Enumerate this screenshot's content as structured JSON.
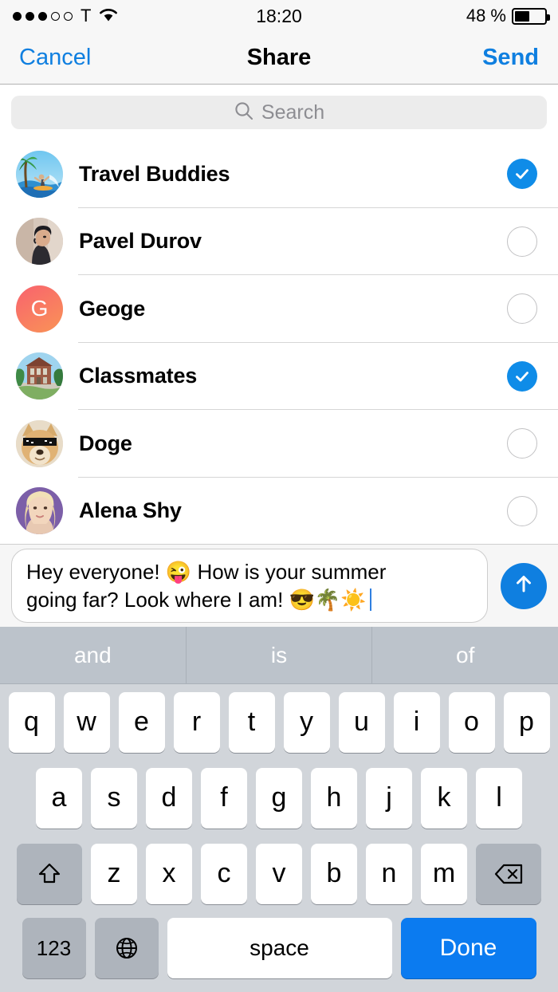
{
  "status_bar": {
    "signal_dots_filled": 3,
    "signal_dots_total": 5,
    "carrier": "T",
    "wifi_icon": "wifi-icon",
    "time": "18:20",
    "battery_percent": "48 %",
    "battery_level": 48
  },
  "navbar": {
    "cancel_label": "Cancel",
    "title": "Share",
    "send_label": "Send"
  },
  "search": {
    "icon": "search-icon",
    "placeholder": "Search",
    "value": ""
  },
  "chat_list": [
    {
      "name": "Travel Buddies",
      "avatar": "beach-surfer-photo",
      "avatar_type": "photo",
      "selected": true
    },
    {
      "name": "Pavel Durov",
      "avatar": "man-portrait-photo",
      "avatar_type": "photo",
      "selected": false
    },
    {
      "name": "Geoge",
      "avatar": "letter-g",
      "avatar_type": "initial",
      "initial": "G",
      "color_start": "#f9626e",
      "color_end": "#f98c5a",
      "selected": false
    },
    {
      "name": "Classmates",
      "avatar": "university-building-photo",
      "avatar_type": "photo",
      "selected": true
    },
    {
      "name": "Doge",
      "avatar": "doge-sunglasses-photo",
      "avatar_type": "photo",
      "selected": false
    },
    {
      "name": "Alena Shy",
      "avatar": "blonde-woman-photo",
      "avatar_type": "photo",
      "selected": false
    }
  ],
  "message_input": {
    "line1": "Hey everyone! 😜  How is your summer",
    "line2": "going far? Look where I am! 😎🌴☀️",
    "has_cursor": true,
    "send_icon": "send-arrow-up-icon"
  },
  "keyboard": {
    "predictions": [
      "and",
      "is",
      "of"
    ],
    "row1": [
      "q",
      "w",
      "e",
      "r",
      "t",
      "y",
      "u",
      "i",
      "o",
      "p"
    ],
    "row2": [
      "a",
      "s",
      "d",
      "f",
      "g",
      "h",
      "j",
      "k",
      "l"
    ],
    "row3": [
      "z",
      "x",
      "c",
      "v",
      "b",
      "n",
      "m"
    ],
    "shift_icon": "shift-arrow-up-icon",
    "backspace_icon": "backspace-delete-icon",
    "numeric_label": "123",
    "globe_icon": "globe-language-icon",
    "space_label": "space",
    "done_label": "Done"
  },
  "colors": {
    "accent_blue": "#0f7fe0",
    "check_blue": "#0f8ce8",
    "done_blue": "#0b7bf0",
    "keyboard_bg": "#d1d5da",
    "nav_bg": "#f7f7f7",
    "search_bg": "#ececec"
  }
}
